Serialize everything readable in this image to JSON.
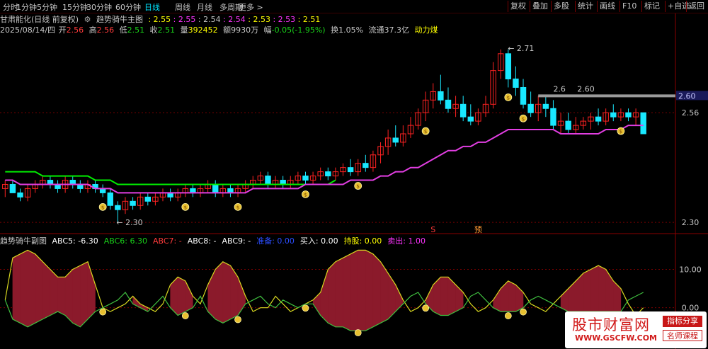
{
  "toolbar": {
    "periods": [
      "分时",
      "1分钟",
      "5分钟",
      "15分钟",
      "30分钟",
      "60分钟",
      "日线",
      "周线",
      "月线",
      "多周期",
      "更多 >"
    ],
    "active_period": "日线",
    "right_buttons": [
      "复权",
      "叠加",
      "多股",
      "统计",
      "画线",
      "F10",
      "标记",
      "+自选",
      "返回"
    ]
  },
  "main_header": {
    "stock": "甘肃能化(日线 前复权)",
    "indicator": "趋势骑牛主图",
    "values": [
      "2.55",
      "2.55",
      "2.54",
      "2.54",
      "2.53",
      "2.53",
      "2.51"
    ]
  },
  "quote": {
    "date": "2025/08/14/四",
    "open_label": "开",
    "open": "2.56",
    "high_label": "高",
    "high": "2.56",
    "low_label": "低",
    "low": "2.51",
    "close_label": "收",
    "close": "2.51",
    "vol_label": "量",
    "vol": "392452",
    "amt_label": "额",
    "amt": "9930万",
    "chg_label": "幅",
    "chg": "-0.05(-1.95%)",
    "turn_label": "换",
    "turn": "1.05%",
    "float_label": "流通",
    "float": "37.3亿",
    "concept": "动力煤"
  },
  "sub_header": {
    "title": "趋势骑牛副图",
    "items": [
      {
        "label": "ABC5: ",
        "value": "-6.30",
        "color": "#ffffff"
      },
      {
        "label": "ABC6: ",
        "value": "6.30",
        "color": "#19d219"
      },
      {
        "label": "ABC7: ",
        "value": "-",
        "color": "#ff3b3b"
      },
      {
        "label": "ABC8: ",
        "value": "-",
        "color": "#ffffff"
      },
      {
        "label": "ABC9: ",
        "value": "-",
        "color": "#ffffff"
      },
      {
        "label": "准备: ",
        "value": "0.00",
        "color": "#2b4dff"
      },
      {
        "label": "买入: ",
        "value": "0.00",
        "color": "#ffffff"
      },
      {
        "label": "持股: ",
        "value": "0.00",
        "color": "#ffff00"
      },
      {
        "label": "卖出: ",
        "value": "1.00",
        "color": "#ff33ff"
      }
    ]
  },
  "main_axis": {
    "ticks": [
      "2.56",
      "2.30"
    ],
    "price_tag": "2.60"
  },
  "sub_axis": {
    "ticks": [
      "10.00",
      "0.00"
    ]
  },
  "annotations": {
    "high": "2.71",
    "low": "2.30",
    "resist_a": "2.60",
    "resist_b": "2.6",
    "s_mark": "S",
    "yu_mark": "预"
  },
  "watermark": {
    "title": "股市财富网",
    "url": "WWW.GSCFW.COM",
    "tag1": "指标分享",
    "tag2": "名师课程"
  },
  "colors": {
    "up": "#ff2222",
    "down": "#19e8ff",
    "green_band": "#00ee00",
    "ma_line": "#e23ee2",
    "fill": "#8b1a2b"
  },
  "chart_data": {
    "type": "candlestick",
    "ylim": [
      2.28,
      2.74
    ],
    "candles": [
      {
        "o": 2.38,
        "h": 2.4,
        "l": 2.36,
        "c": 2.39
      },
      {
        "o": 2.39,
        "h": 2.4,
        "l": 2.37,
        "c": 2.37
      },
      {
        "o": 2.37,
        "h": 2.38,
        "l": 2.35,
        "c": 2.36
      },
      {
        "o": 2.36,
        "h": 2.39,
        "l": 2.35,
        "c": 2.38
      },
      {
        "o": 2.38,
        "h": 2.4,
        "l": 2.37,
        "c": 2.39
      },
      {
        "o": 2.39,
        "h": 2.41,
        "l": 2.38,
        "c": 2.4
      },
      {
        "o": 2.4,
        "h": 2.41,
        "l": 2.38,
        "c": 2.39
      },
      {
        "o": 2.39,
        "h": 2.4,
        "l": 2.37,
        "c": 2.38
      },
      {
        "o": 2.38,
        "h": 2.41,
        "l": 2.37,
        "c": 2.4
      },
      {
        "o": 2.4,
        "h": 2.41,
        "l": 2.38,
        "c": 2.39
      },
      {
        "o": 2.39,
        "h": 2.4,
        "l": 2.37,
        "c": 2.38
      },
      {
        "o": 2.38,
        "h": 2.4,
        "l": 2.37,
        "c": 2.39
      },
      {
        "o": 2.39,
        "h": 2.4,
        "l": 2.37,
        "c": 2.38
      },
      {
        "o": 2.38,
        "h": 2.39,
        "l": 2.36,
        "c": 2.37
      },
      {
        "o": 2.37,
        "h": 2.38,
        "l": 2.33,
        "c": 2.34
      },
      {
        "o": 2.34,
        "h": 2.35,
        "l": 2.3,
        "c": 2.33
      },
      {
        "o": 2.33,
        "h": 2.36,
        "l": 2.32,
        "c": 2.35
      },
      {
        "o": 2.35,
        "h": 2.36,
        "l": 2.33,
        "c": 2.34
      },
      {
        "o": 2.34,
        "h": 2.37,
        "l": 2.33,
        "c": 2.36
      },
      {
        "o": 2.36,
        "h": 2.37,
        "l": 2.34,
        "c": 2.35
      },
      {
        "o": 2.35,
        "h": 2.37,
        "l": 2.34,
        "c": 2.36
      },
      {
        "o": 2.36,
        "h": 2.38,
        "l": 2.35,
        "c": 2.37
      },
      {
        "o": 2.37,
        "h": 2.38,
        "l": 2.35,
        "c": 2.36
      },
      {
        "o": 2.36,
        "h": 2.38,
        "l": 2.35,
        "c": 2.37
      },
      {
        "o": 2.37,
        "h": 2.39,
        "l": 2.36,
        "c": 2.38
      },
      {
        "o": 2.38,
        "h": 2.39,
        "l": 2.36,
        "c": 2.37
      },
      {
        "o": 2.37,
        "h": 2.39,
        "l": 2.36,
        "c": 2.38
      },
      {
        "o": 2.38,
        "h": 2.4,
        "l": 2.37,
        "c": 2.39
      },
      {
        "o": 2.39,
        "h": 2.4,
        "l": 2.36,
        "c": 2.37
      },
      {
        "o": 2.37,
        "h": 2.39,
        "l": 2.36,
        "c": 2.38
      },
      {
        "o": 2.38,
        "h": 2.39,
        "l": 2.36,
        "c": 2.37
      },
      {
        "o": 2.37,
        "h": 2.39,
        "l": 2.36,
        "c": 2.38
      },
      {
        "o": 2.38,
        "h": 2.4,
        "l": 2.37,
        "c": 2.39
      },
      {
        "o": 2.39,
        "h": 2.41,
        "l": 2.38,
        "c": 2.4
      },
      {
        "o": 2.4,
        "h": 2.42,
        "l": 2.39,
        "c": 2.41
      },
      {
        "o": 2.41,
        "h": 2.42,
        "l": 2.38,
        "c": 2.39
      },
      {
        "o": 2.39,
        "h": 2.41,
        "l": 2.38,
        "c": 2.4
      },
      {
        "o": 2.4,
        "h": 2.41,
        "l": 2.38,
        "c": 2.39
      },
      {
        "o": 2.39,
        "h": 2.41,
        "l": 2.38,
        "c": 2.4
      },
      {
        "o": 2.4,
        "h": 2.42,
        "l": 2.39,
        "c": 2.41
      },
      {
        "o": 2.41,
        "h": 2.42,
        "l": 2.39,
        "c": 2.4
      },
      {
        "o": 2.4,
        "h": 2.42,
        "l": 2.39,
        "c": 2.41
      },
      {
        "o": 2.41,
        "h": 2.43,
        "l": 2.4,
        "c": 2.42
      },
      {
        "o": 2.42,
        "h": 2.43,
        "l": 2.4,
        "c": 2.41
      },
      {
        "o": 2.41,
        "h": 2.43,
        "l": 2.4,
        "c": 2.42
      },
      {
        "o": 2.42,
        "h": 2.44,
        "l": 2.41,
        "c": 2.43
      },
      {
        "o": 2.43,
        "h": 2.45,
        "l": 2.41,
        "c": 2.42
      },
      {
        "o": 2.42,
        "h": 2.45,
        "l": 2.41,
        "c": 2.44
      },
      {
        "o": 2.44,
        "h": 2.46,
        "l": 2.42,
        "c": 2.43
      },
      {
        "o": 2.43,
        "h": 2.47,
        "l": 2.42,
        "c": 2.46
      },
      {
        "o": 2.46,
        "h": 2.49,
        "l": 2.44,
        "c": 2.48
      },
      {
        "o": 2.48,
        "h": 2.52,
        "l": 2.46,
        "c": 2.5
      },
      {
        "o": 2.5,
        "h": 2.53,
        "l": 2.48,
        "c": 2.49
      },
      {
        "o": 2.49,
        "h": 2.53,
        "l": 2.48,
        "c": 2.51
      },
      {
        "o": 2.51,
        "h": 2.55,
        "l": 2.5,
        "c": 2.53
      },
      {
        "o": 2.53,
        "h": 2.57,
        "l": 2.52,
        "c": 2.56
      },
      {
        "o": 2.56,
        "h": 2.61,
        "l": 2.54,
        "c": 2.59
      },
      {
        "o": 2.59,
        "h": 2.63,
        "l": 2.57,
        "c": 2.61
      },
      {
        "o": 2.61,
        "h": 2.65,
        "l": 2.58,
        "c": 2.59
      },
      {
        "o": 2.59,
        "h": 2.62,
        "l": 2.56,
        "c": 2.57
      },
      {
        "o": 2.57,
        "h": 2.6,
        "l": 2.55,
        "c": 2.58
      },
      {
        "o": 2.58,
        "h": 2.6,
        "l": 2.54,
        "c": 2.55
      },
      {
        "o": 2.55,
        "h": 2.58,
        "l": 2.53,
        "c": 2.54
      },
      {
        "o": 2.54,
        "h": 2.57,
        "l": 2.53,
        "c": 2.56
      },
      {
        "o": 2.56,
        "h": 2.6,
        "l": 2.55,
        "c": 2.58
      },
      {
        "o": 2.58,
        "h": 2.68,
        "l": 2.57,
        "c": 2.66
      },
      {
        "o": 2.66,
        "h": 2.71,
        "l": 2.64,
        "c": 2.7
      },
      {
        "o": 2.7,
        "h": 2.71,
        "l": 2.62,
        "c": 2.64
      },
      {
        "o": 2.64,
        "h": 2.67,
        "l": 2.6,
        "c": 2.62
      },
      {
        "o": 2.62,
        "h": 2.64,
        "l": 2.57,
        "c": 2.58
      },
      {
        "o": 2.58,
        "h": 2.61,
        "l": 2.55,
        "c": 2.56
      },
      {
        "o": 2.56,
        "h": 2.6,
        "l": 2.54,
        "c": 2.58
      },
      {
        "o": 2.58,
        "h": 2.6,
        "l": 2.55,
        "c": 2.57
      },
      {
        "o": 2.57,
        "h": 2.59,
        "l": 2.52,
        "c": 2.53
      },
      {
        "o": 2.53,
        "h": 2.56,
        "l": 2.51,
        "c": 2.54
      },
      {
        "o": 2.54,
        "h": 2.56,
        "l": 2.51,
        "c": 2.52
      },
      {
        "o": 2.52,
        "h": 2.55,
        "l": 2.51,
        "c": 2.53
      },
      {
        "o": 2.53,
        "h": 2.55,
        "l": 2.52,
        "c": 2.54
      },
      {
        "o": 2.54,
        "h": 2.56,
        "l": 2.52,
        "c": 2.55
      },
      {
        "o": 2.55,
        "h": 2.57,
        "l": 2.53,
        "c": 2.54
      },
      {
        "o": 2.54,
        "h": 2.57,
        "l": 2.53,
        "c": 2.56
      },
      {
        "o": 2.56,
        "h": 2.58,
        "l": 2.54,
        "c": 2.55
      },
      {
        "o": 2.55,
        "h": 2.57,
        "l": 2.54,
        "c": 2.56
      },
      {
        "o": 2.56,
        "h": 2.57,
        "l": 2.54,
        "c": 2.55
      },
      {
        "o": 2.55,
        "h": 2.57,
        "l": 2.53,
        "c": 2.56
      },
      {
        "o": 2.56,
        "h": 2.56,
        "l": 2.51,
        "c": 2.51
      }
    ],
    "ma_line": [
      2.4,
      2.4,
      2.39,
      2.39,
      2.39,
      2.39,
      2.39,
      2.39,
      2.39,
      2.39,
      2.39,
      2.39,
      2.38,
      2.38,
      2.38,
      2.37,
      2.37,
      2.37,
      2.37,
      2.37,
      2.37,
      2.37,
      2.37,
      2.37,
      2.37,
      2.37,
      2.37,
      2.37,
      2.37,
      2.37,
      2.37,
      2.37,
      2.37,
      2.38,
      2.38,
      2.38,
      2.38,
      2.38,
      2.38,
      2.38,
      2.39,
      2.39,
      2.39,
      2.39,
      2.39,
      2.39,
      2.4,
      2.4,
      2.4,
      2.4,
      2.41,
      2.41,
      2.42,
      2.42,
      2.43,
      2.43,
      2.44,
      2.45,
      2.46,
      2.47,
      2.47,
      2.48,
      2.48,
      2.49,
      2.49,
      2.5,
      2.51,
      2.52,
      2.52,
      2.52,
      2.52,
      2.52,
      2.52,
      2.52,
      2.51,
      2.51,
      2.51,
      2.51,
      2.51,
      2.51,
      2.52,
      2.52,
      2.52,
      2.53,
      2.53,
      2.53
    ],
    "band_line": [
      2.42,
      2.42,
      2.42,
      2.42,
      2.42,
      2.41,
      2.41,
      2.41,
      2.41,
      2.41,
      2.41,
      2.41,
      2.4,
      2.4,
      2.4,
      2.39,
      2.39,
      2.39,
      2.39,
      2.39,
      2.39,
      2.39,
      2.39,
      2.39,
      2.39,
      2.39,
      2.39,
      2.39,
      2.39,
      2.39,
      2.39,
      2.39,
      2.39,
      2.39,
      2.39,
      2.39,
      2.39,
      2.39,
      2.39,
      2.39,
      2.39,
      2.39,
      2.39,
      2.39,
      2.4
    ],
    "sub_ylim": [
      -8,
      16
    ],
    "sub_up": [
      2,
      13,
      14,
      15,
      14,
      12,
      10,
      8,
      8,
      10,
      11,
      12,
      6,
      0,
      -1,
      0,
      1,
      3,
      1,
      0,
      -1,
      1,
      6,
      8,
      7,
      3,
      1,
      6,
      10,
      12,
      11,
      8,
      3,
      -1,
      0,
      0,
      3,
      1,
      -1,
      0,
      1,
      2,
      4,
      10,
      12,
      13,
      14,
      15,
      15,
      14,
      12,
      9,
      6,
      2,
      -1,
      0,
      2,
      6,
      8,
      8,
      6,
      4,
      1,
      -1,
      0,
      2,
      5,
      7,
      6,
      4,
      1,
      0,
      -1,
      1,
      3,
      5,
      7,
      9,
      10,
      11,
      10,
      7,
      5,
      1,
      -2,
      0
    ],
    "sub_down": [
      2,
      -3,
      -4,
      -5,
      -4,
      -3,
      -2,
      -1,
      -2,
      -4,
      -5,
      -3,
      -1,
      0,
      1,
      2,
      4,
      1,
      0,
      -1,
      1,
      3,
      0,
      -2,
      -1,
      0,
      3,
      -1,
      -3,
      -4,
      -3,
      -2,
      1,
      2,
      3,
      1,
      0,
      2,
      1,
      0,
      1,
      1,
      -2,
      -4,
      -5,
      -5,
      -6,
      -6,
      -6,
      -5,
      -4,
      -3,
      -1,
      1,
      3,
      4,
      1,
      -1,
      -2,
      -2,
      -1,
      0,
      3,
      4,
      2,
      0,
      -1,
      -1,
      -1,
      0,
      2,
      3,
      2,
      1,
      0,
      -1,
      -1,
      -1,
      -1,
      -1,
      -1,
      -1,
      -1,
      2,
      3,
      4
    ],
    "signals": [
      13,
      24,
      31,
      40,
      47,
      56,
      67,
      69,
      82
    ],
    "tick_labels_main": [
      "2.56",
      "2.30"
    ],
    "tick_labels_sub": [
      "10.00",
      "0.00"
    ]
  }
}
